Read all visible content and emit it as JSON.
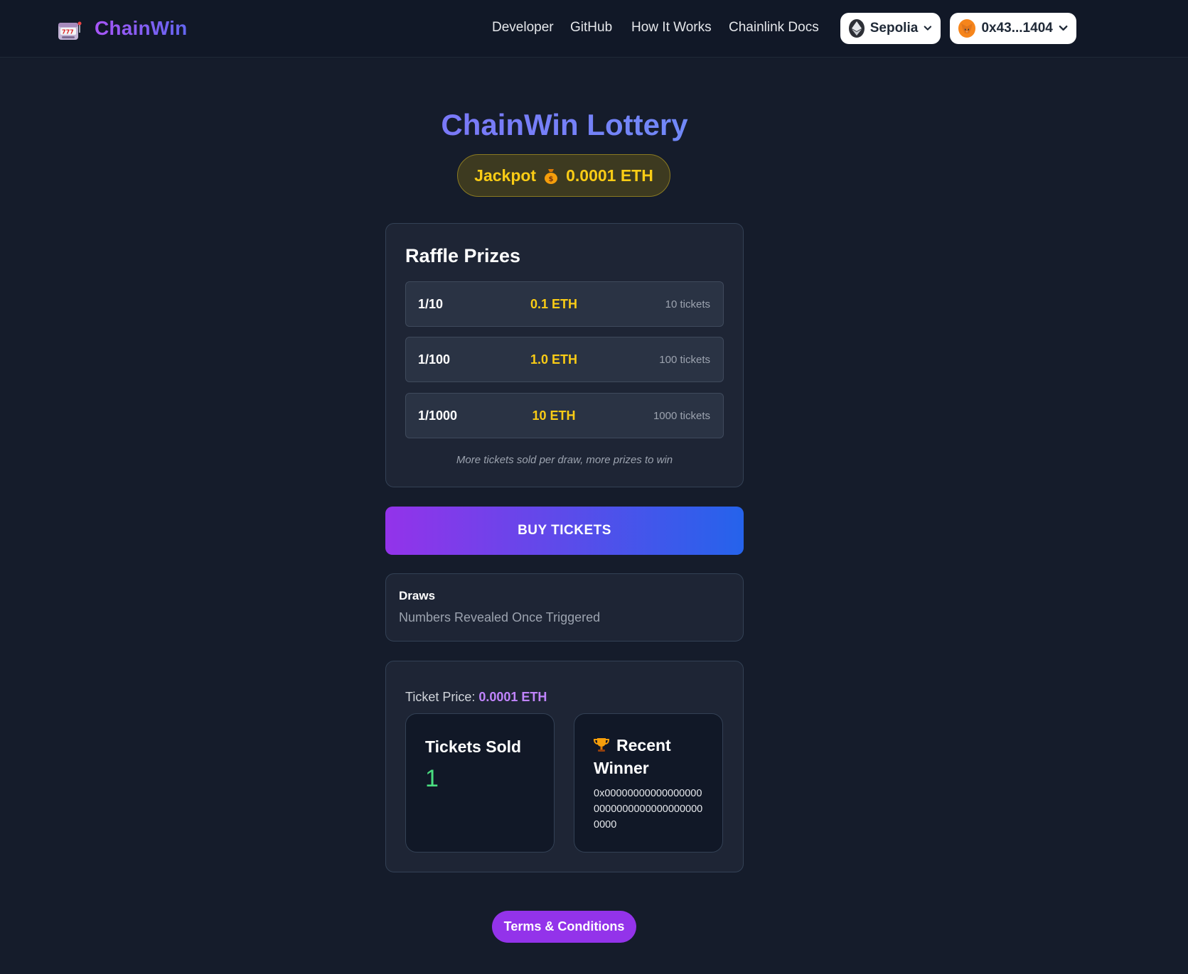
{
  "header": {
    "brand": "ChainWin",
    "nav": [
      "Developer",
      "GitHub",
      "How It Works",
      "Chainlink Docs"
    ],
    "network": "Sepolia",
    "account": "0x43...1404",
    "icons": {
      "logo": "slot-machine-icon",
      "network": "ethereum-icon",
      "account": "metamask-fox-icon",
      "dropdown": "chevron-down-icon"
    }
  },
  "hero": {
    "title": "ChainWin Lottery",
    "jackpot_label": "Jackpot",
    "jackpot_icon": "money-bag-icon",
    "jackpot_value": "0.0001 ETH"
  },
  "prizes": {
    "title": "Raffle Prizes",
    "rows": [
      {
        "odds": "1/10",
        "amount": "0.1 ETH",
        "tickets": "10 tickets"
      },
      {
        "odds": "1/100",
        "amount": "1.0 ETH",
        "tickets": "100 tickets"
      },
      {
        "odds": "1/1000",
        "amount": "10 ETH",
        "tickets": "1000 tickets"
      }
    ],
    "note": "More tickets sold per draw, more prizes to win"
  },
  "buy_button": "BUY TICKETS",
  "draws": {
    "label": "Draws",
    "text": "Numbers Revealed Once Triggered"
  },
  "stats": {
    "price_label": "Ticket Price:",
    "price_value": "0.0001 ETH",
    "sold_title": "Tickets Sold",
    "sold_value": "1",
    "winner_icon": "trophy-icon",
    "winner_title": "Recent Winner",
    "winner_address": "0x0000000000000000000000000000000000000000"
  },
  "footer": {
    "terms": "Terms & Conditions"
  },
  "colors": {
    "background": "#151c2b",
    "accent_purple": "#9333ea",
    "accent_blue": "#2563eb",
    "gold": "#facc15",
    "green": "#4ade80"
  }
}
